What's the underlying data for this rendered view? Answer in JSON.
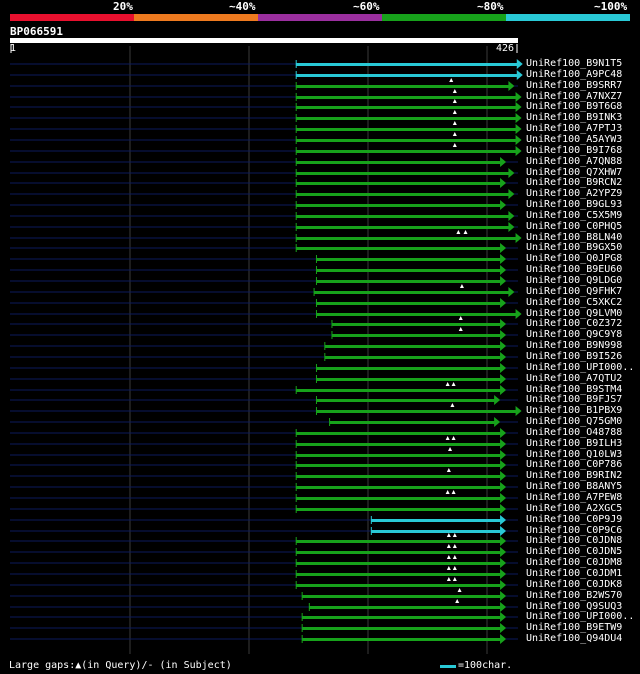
{
  "legend": {
    "labels": [
      "20%",
      "~40%",
      "~60%",
      "~80%",
      "~100%"
    ],
    "colors": [
      "#e8102e",
      "#ee7a1f",
      "#9b2f9f",
      "#17a21b",
      "#29c9d6"
    ]
  },
  "query": {
    "id": "BP066591",
    "start": "1",
    "end": "426",
    "length": 426
  },
  "hits": [
    {
      "name": "UniRef100_B9N1T5",
      "start": 240,
      "end": 430,
      "color": "cyan",
      "gaps": []
    },
    {
      "name": "UniRef100_A9PC48",
      "start": 240,
      "end": 430,
      "color": "cyan",
      "gaps": []
    },
    {
      "name": "UniRef100_B9SRR7",
      "start": 240,
      "end": 423,
      "color": "green",
      "gaps": [
        370
      ]
    },
    {
      "name": "UniRef100_A7NXZ7",
      "start": 240,
      "end": 429,
      "color": "green",
      "gaps": [
        373
      ]
    },
    {
      "name": "UniRef100_B9T6G8",
      "start": 240,
      "end": 429,
      "color": "green",
      "gaps": [
        373
      ]
    },
    {
      "name": "UniRef100_B9INK3",
      "start": 240,
      "end": 429,
      "color": "green",
      "gaps": [
        373
      ]
    },
    {
      "name": "UniRef100_A7PTJ3",
      "start": 240,
      "end": 429,
      "color": "green",
      "gaps": [
        373
      ]
    },
    {
      "name": "UniRef100_A5AYW3",
      "start": 240,
      "end": 429,
      "color": "green",
      "gaps": [
        373
      ]
    },
    {
      "name": "UniRef100_B9I768",
      "start": 240,
      "end": 429,
      "color": "green",
      "gaps": [
        373
      ]
    },
    {
      "name": "UniRef100_A7QN88",
      "start": 240,
      "end": 416,
      "color": "green",
      "gaps": []
    },
    {
      "name": "UniRef100_Q7XHW7",
      "start": 240,
      "end": 423,
      "color": "green",
      "gaps": []
    },
    {
      "name": "UniRef100_B9RCN2",
      "start": 240,
      "end": 416,
      "color": "green",
      "gaps": []
    },
    {
      "name": "UniRef100_A2YPZ9",
      "start": 240,
      "end": 423,
      "color": "green",
      "gaps": []
    },
    {
      "name": "UniRef100_B9GL93",
      "start": 240,
      "end": 416,
      "color": "green",
      "gaps": []
    },
    {
      "name": "UniRef100_C5X5M9",
      "start": 240,
      "end": 423,
      "color": "green",
      "gaps": []
    },
    {
      "name": "UniRef100_C0PHQ5",
      "start": 240,
      "end": 423,
      "color": "green",
      "gaps": []
    },
    {
      "name": "UniRef100_B8LN40",
      "start": 240,
      "end": 429,
      "color": "green",
      "gaps": [
        376,
        382
      ]
    },
    {
      "name": "UniRef100_B9GX50",
      "start": 240,
      "end": 416,
      "color": "green",
      "gaps": []
    },
    {
      "name": "UniRef100_Q0JPG8",
      "start": 257,
      "end": 416,
      "color": "green",
      "gaps": []
    },
    {
      "name": "UniRef100_B9EU60",
      "start": 257,
      "end": 416,
      "color": "green",
      "gaps": []
    },
    {
      "name": "UniRef100_Q9LDG0",
      "start": 257,
      "end": 416,
      "color": "green",
      "gaps": []
    },
    {
      "name": "UniRef100_Q9FHK7",
      "start": 255,
      "end": 423,
      "color": "green",
      "gaps": [
        379
      ]
    },
    {
      "name": "UniRef100_C5XKC2",
      "start": 257,
      "end": 416,
      "color": "green",
      "gaps": []
    },
    {
      "name": "UniRef100_Q9LVM0",
      "start": 257,
      "end": 429,
      "color": "green",
      "gaps": []
    },
    {
      "name": "UniRef100_C0Z372",
      "start": 270,
      "end": 416,
      "color": "green",
      "gaps": [
        378
      ]
    },
    {
      "name": "UniRef100_Q9C9Y8",
      "start": 270,
      "end": 416,
      "color": "green",
      "gaps": [
        378
      ]
    },
    {
      "name": "UniRef100_B9N998",
      "start": 264,
      "end": 416,
      "color": "green",
      "gaps": []
    },
    {
      "name": "UniRef100_B9I526",
      "start": 264,
      "end": 416,
      "color": "green",
      "gaps": []
    },
    {
      "name": "UniRef100_UPI000..",
      "start": 257,
      "end": 416,
      "color": "green",
      "gaps": []
    },
    {
      "name": "UniRef100_A7QTU2",
      "start": 257,
      "end": 416,
      "color": "green",
      "gaps": []
    },
    {
      "name": "UniRef100_B9STM4",
      "start": 240,
      "end": 416,
      "color": "green",
      "gaps": [
        367,
        372
      ]
    },
    {
      "name": "UniRef100_B9FJS7",
      "start": 257,
      "end": 411,
      "color": "green",
      "gaps": []
    },
    {
      "name": "UniRef100_B1PBX9",
      "start": 257,
      "end": 429,
      "color": "green",
      "gaps": [
        371
      ]
    },
    {
      "name": "UniRef100_Q75GM0",
      "start": 268,
      "end": 411,
      "color": "green",
      "gaps": []
    },
    {
      "name": "UniRef100_O48788",
      "start": 240,
      "end": 416,
      "color": "green",
      "gaps": []
    },
    {
      "name": "UniRef100_B9ILH3",
      "start": 240,
      "end": 416,
      "color": "green",
      "gaps": [
        367,
        372
      ]
    },
    {
      "name": "UniRef100_Q10LW3",
      "start": 240,
      "end": 416,
      "color": "green",
      "gaps": [
        369
      ]
    },
    {
      "name": "UniRef100_C0P786",
      "start": 240,
      "end": 416,
      "color": "green",
      "gaps": []
    },
    {
      "name": "UniRef100_B9RIN2",
      "start": 240,
      "end": 416,
      "color": "green",
      "gaps": [
        368
      ]
    },
    {
      "name": "UniRef100_B8ANY5",
      "start": 240,
      "end": 416,
      "color": "green",
      "gaps": []
    },
    {
      "name": "UniRef100_A7PEW8",
      "start": 240,
      "end": 416,
      "color": "green",
      "gaps": [
        367,
        372
      ]
    },
    {
      "name": "UniRef100_A2XGC5",
      "start": 240,
      "end": 416,
      "color": "green",
      "gaps": []
    },
    {
      "name": "UniRef100_C0P9J9",
      "start": 303,
      "end": 416,
      "color": "cyan",
      "gaps": []
    },
    {
      "name": "UniRef100_C0P9C6",
      "start": 303,
      "end": 416,
      "color": "cyan",
      "gaps": []
    },
    {
      "name": "UniRef100_C0JDN8",
      "start": 240,
      "end": 416,
      "color": "green",
      "gaps": [
        368,
        373
      ]
    },
    {
      "name": "UniRef100_C0JDN5",
      "start": 240,
      "end": 416,
      "color": "green",
      "gaps": [
        368,
        373
      ]
    },
    {
      "name": "UniRef100_C0JDM8",
      "start": 240,
      "end": 416,
      "color": "green",
      "gaps": [
        368,
        373
      ]
    },
    {
      "name": "UniRef100_C0JDM1",
      "start": 240,
      "end": 416,
      "color": "green",
      "gaps": [
        368,
        373
      ]
    },
    {
      "name": "UniRef100_C0JDK8",
      "start": 240,
      "end": 416,
      "color": "green",
      "gaps": [
        368,
        373
      ]
    },
    {
      "name": "UniRef100_B2WS70",
      "start": 245,
      "end": 416,
      "color": "green",
      "gaps": [
        377
      ]
    },
    {
      "name": "UniRef100_Q9SUQ3",
      "start": 251,
      "end": 416,
      "color": "green",
      "gaps": [
        375
      ]
    },
    {
      "name": "UniRef100_UPI000..",
      "start": 245,
      "end": 416,
      "color": "green",
      "gaps": []
    },
    {
      "name": "UniRef100_B9ETW9",
      "start": 245,
      "end": 416,
      "color": "green",
      "gaps": []
    },
    {
      "name": "UniRef100_Q94DU4",
      "start": 245,
      "end": 416,
      "color": "green",
      "gaps": []
    }
  ],
  "footer": {
    "gaps_note": "Large gaps:▲(in Query)/- (in Subject)",
    "scale_label": "=100char."
  }
}
